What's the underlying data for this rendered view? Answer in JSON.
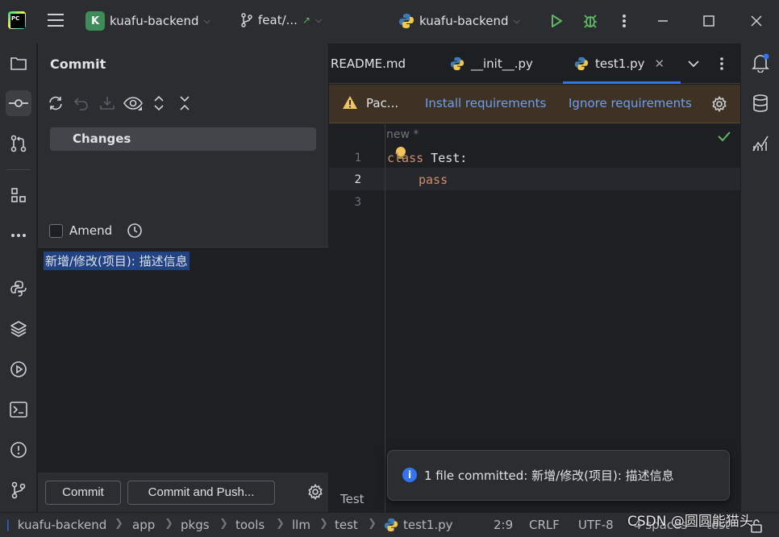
{
  "titlebar": {
    "project_badge": "K",
    "project_name": "kuafu-backend",
    "branch": "feat/...",
    "run_config": "kuafu-backend"
  },
  "commit_panel": {
    "title": "Commit",
    "changes_label": "Changes",
    "amend_label": "Amend",
    "message": "新增/修改(项目): 描述信息",
    "commit_button": "Commit",
    "commit_push_button": "Commit and Push..."
  },
  "editor": {
    "tabs": [
      {
        "label": "README.md"
      },
      {
        "label": "__init__.py"
      },
      {
        "label": "test1.py",
        "active": true
      }
    ],
    "banner": {
      "message": "Pac...",
      "install_link": "Install requirements",
      "ignore_link": "Ignore requirements"
    },
    "hint": "new *",
    "line_numbers": [
      "1",
      "2",
      "3"
    ],
    "code": {
      "line1_kw": "class",
      "line1_rest": " Test:",
      "line2_kw": "pass"
    },
    "bottom_tab": "Test"
  },
  "notification": {
    "text": "1 file committed: 新增/修改(项目): 描述信息"
  },
  "statusbar": {
    "breadcrumbs": [
      "kuafu-backend",
      "app",
      "pkgs",
      "tools",
      "llm",
      "test",
      "test1.py"
    ],
    "position": "2:9",
    "line_ending": "CRLF",
    "encoding": "UTF-8",
    "indent": "4 spaces",
    "interpreter": "test"
  },
  "watermark": "CSDN @圆圆能猫头",
  "colors": {
    "accent": "#3574f0",
    "keyword": "#cf8e6d",
    "success": "#5fb865",
    "warning": "#f2c55c"
  }
}
